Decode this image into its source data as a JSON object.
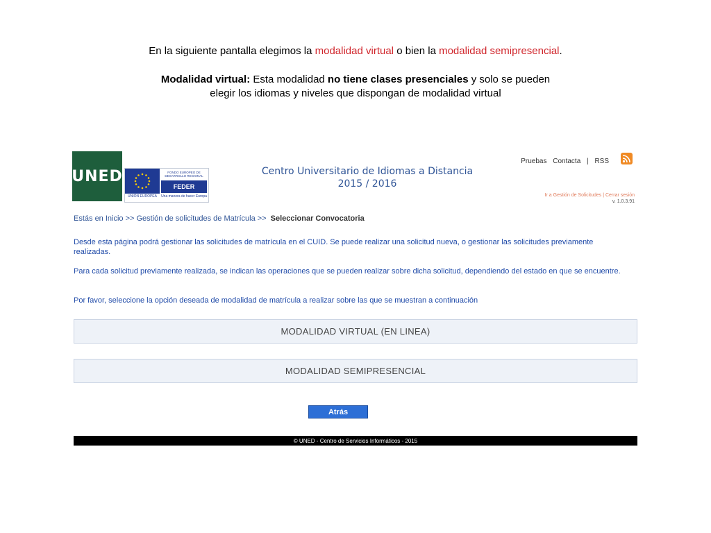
{
  "slide": {
    "intro": {
      "prefix": "En la siguiente pantalla elegimos la ",
      "link1": "modalidad  virtual",
      "middle": " o bien  la ",
      "link2": "modalidad semipresencial",
      "suffix": "."
    },
    "bullet": {
      "glyph": "",
      "bold1": "Modalidad virtual:",
      "text1": " Esta modalidad ",
      "bold2": "no tiene clases presenciales",
      "text2": " y solo se pueden",
      "line2": "elegir los idiomas y niveles que dispongan de modalidad virtual"
    }
  },
  "app": {
    "logo": "UNED",
    "feder": {
      "fondo": "FONDO EUROPEO DE DESARROLLO REGIONAL",
      "name": "FEDER",
      "eu": "UNIÓN EUROPEA",
      "motto": "Una manera de hacer Europa"
    },
    "title_line1": "Centro Universitario de Idiomas a Distancia",
    "title_line2": "2015 / 2016",
    "top_links": [
      "Pruebas",
      "Contacta",
      "|",
      "RSS"
    ],
    "gestion_links": "Ir a Gestión de Solicitudes | Cerrar sesión",
    "version": "v. 1.0.3.91",
    "breadcrumb": {
      "path": "Estás en Inicio >> Gestión de solicitudes de Matrícula >>",
      "current": "Seleccionar Convocatoria"
    },
    "paragraphs": [
      "Desde esta página podrá gestionar las solicitudes de matrícula en el CUID. Se puede realizar una solicitud nueva, o gestionar las solicitudes previamente realizadas.",
      "Para cada solicitud previamente realizada, se indican las operaciones que se pueden realizar sobre dicha solicitud, dependiendo del estado en que se encuentre.",
      "Por favor, seleccione la opción deseada de modalidad de matrícula a realizar sobre las que se muestran a continuación"
    ],
    "buttons": {
      "virtual": "MODALIDAD VIRTUAL (EN LINEA)",
      "semipresencial": "MODALIDAD SEMIPRESENCIAL",
      "back": "Atrás"
    },
    "footer": "© UNED - Centro de Servicios Informáticos - 2015",
    "colors": {
      "uned_green": "#1e5e3c",
      "accent_red": "#d0252b",
      "link_blue": "#1f4aa8",
      "title_blue": "#2f5496"
    }
  }
}
